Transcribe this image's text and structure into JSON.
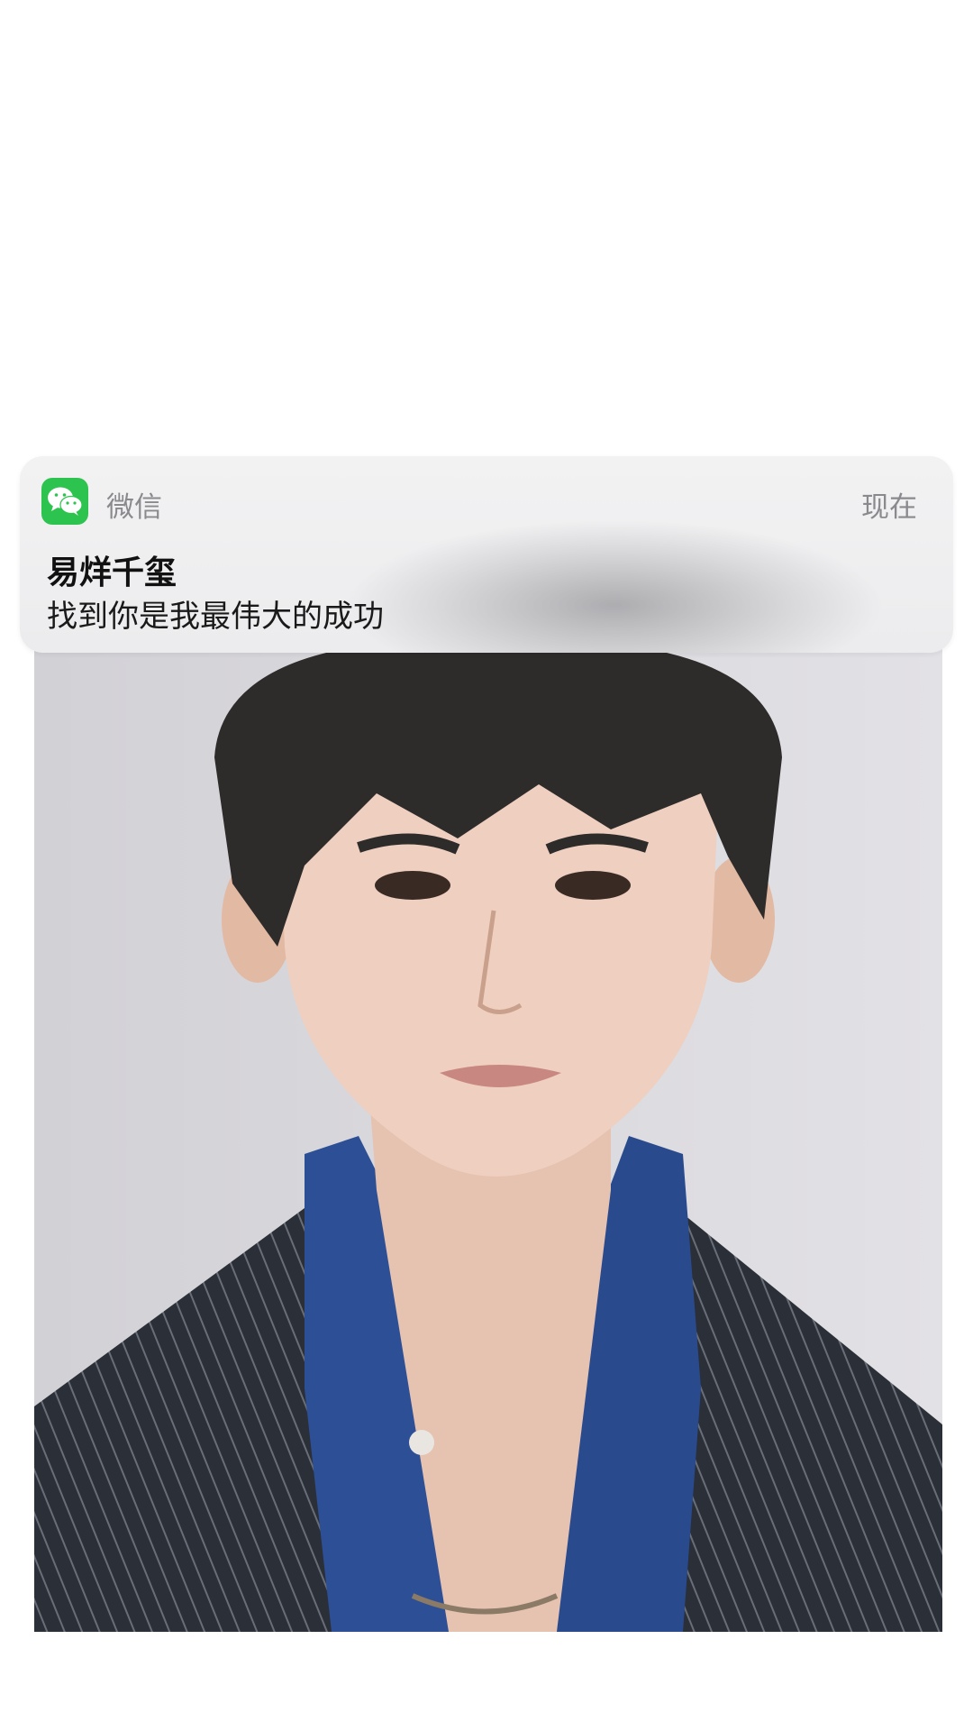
{
  "notification": {
    "app_icon": "wechat-icon",
    "app_name": "微信",
    "time": "现在",
    "sender": "易烊千玺",
    "message": "找到你是我最伟大的成功"
  },
  "colors": {
    "wechat_green": "#2dc34f",
    "background": "#ffffff",
    "banner": "#ececee"
  }
}
